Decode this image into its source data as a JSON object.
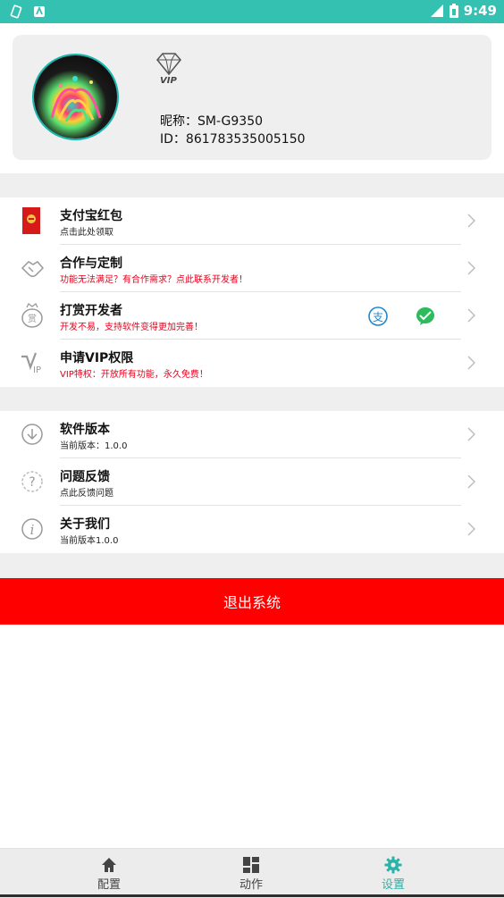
{
  "statusbar": {
    "time": "9:49",
    "color": "#35c1b2",
    "left_icons": [
      "rotate-icon",
      "app-notification-icon"
    ],
    "right_icons": [
      "signal-icon",
      "battery-icon"
    ]
  },
  "profile": {
    "nickname": "昵称：SM-G9350",
    "id": "ID：861783535005150",
    "vip_badge_text": "VIP"
  },
  "group1": [
    {
      "icon": "red-envelope-icon",
      "title": "支付宝红包",
      "subtitle": "点击此处领取",
      "subtitle_color": "#222222"
    },
    {
      "icon": "handshake-icon",
      "title": "合作与定制",
      "subtitle": "功能无法满足？有合作需求？点此联系开发者！",
      "subtitle_color": "#e8001c"
    },
    {
      "icon": "reward-icon",
      "title": "打赏开发者",
      "subtitle": "开发不易，支持软件变得更加完善！",
      "subtitle_color": "#e8001c"
    },
    {
      "icon": "vip-icon",
      "title": "申请VIP权限",
      "subtitle": "VIP特权：开放所有功能，永久免费！",
      "subtitle_color": "#e8001c"
    }
  ],
  "group2": [
    {
      "icon": "download-icon",
      "title": "软件版本",
      "subtitle": "当前版本：1.0.0"
    },
    {
      "icon": "question-icon",
      "title": "问题反馈",
      "subtitle": "点此反馈问题"
    },
    {
      "icon": "info-icon",
      "title": "关于我们",
      "subtitle": "当前版本1.0.0"
    }
  ],
  "logout": {
    "label": "退出系统",
    "color": "#fe0000"
  },
  "nav": [
    {
      "icon": "home-icon",
      "label": "配置",
      "active": false
    },
    {
      "icon": "dashboard-icon",
      "label": "动作",
      "active": false
    },
    {
      "icon": "gear-icon",
      "label": "设置",
      "active": true
    }
  ],
  "colors": {
    "accent": "#2ab3a8",
    "alipay": "#1e88d0",
    "wechat": "#2dbb5c"
  }
}
